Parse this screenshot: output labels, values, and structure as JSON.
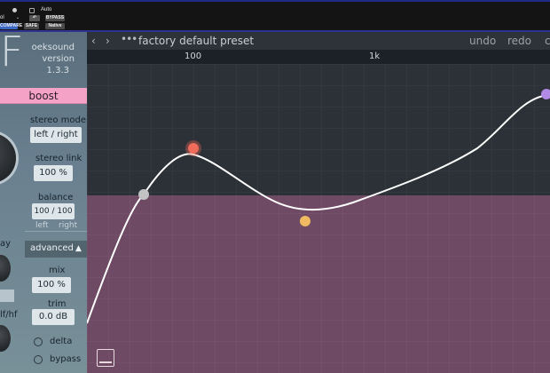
{
  "host": {
    "auto_label": "Auto",
    "bypass_label": "BYPASS",
    "compare_label": "COMPARE",
    "safe_label": "SAFE",
    "native_label": "Native",
    "preset_fragment": "ol"
  },
  "plugin": {
    "logo_text": "F",
    "brand_name": "oeksound",
    "version_label": "version",
    "version_number": "1.3.3",
    "mode_button": "boost"
  },
  "left_panel": {
    "stereo_mode_label": "stereo mode",
    "stereo_mode_value": "left / right",
    "stereo_link_label": "stereo link",
    "stereo_link_value": "100 %",
    "balance_label": "balance",
    "balance_value": "100 / 100",
    "balance_left": "left",
    "balance_right": "right",
    "delay_label_fragment": "ay",
    "lfhf_label_fragment": "lf/hf",
    "advanced_label": "advanced",
    "mix_label": "mix",
    "mix_value": "100 %",
    "trim_label": "trim",
    "trim_value": "0.0 dB",
    "delta_label": "delta",
    "bypass_label": "bypass"
  },
  "toolbar": {
    "preset_name": "factory default preset",
    "undo_label": "undo",
    "redo_label": "redo",
    "edge_fragment": "c"
  },
  "frequency_axis": {
    "tick_labels": [
      "100",
      "1k"
    ]
  },
  "colors": {
    "plot_background_top": "#2b3136",
    "plot_background_bottom": "#6f4a64",
    "mode_button": "#f4a3c7",
    "curve": "#ffffff",
    "node_colors": [
      "#c2c2c2",
      "#ef6b5a",
      "#f0ba62",
      "#b18ae6"
    ]
  },
  "icons": {
    "back": "chevron-left-icon",
    "forward": "chevron-right-icon",
    "menu": "ellipsis-icon",
    "advanced_toggle": "triangle-up-icon",
    "graph_toggle": "graph-toggle-icon"
  }
}
